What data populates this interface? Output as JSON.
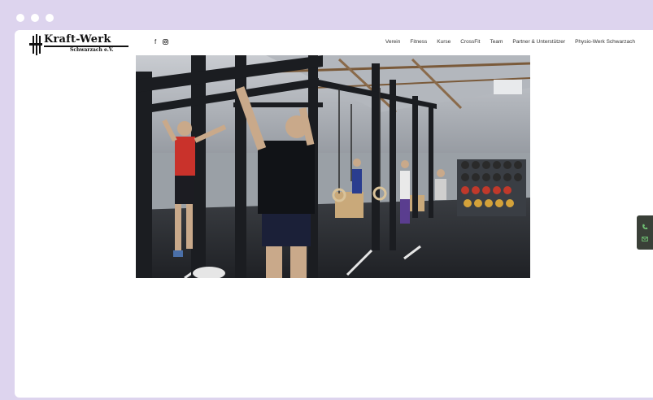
{
  "brand": {
    "title": "Kraft-Werk",
    "subtitle": "Schwarzach e.V."
  },
  "social": {
    "facebook_label": "f",
    "facebook_icon": "facebook-icon",
    "instagram_icon": "instagram-icon"
  },
  "nav": {
    "items": [
      "Verein",
      "Fitness",
      "Kurse",
      "CrossFit",
      "Team",
      "Partner & Unterstützer",
      "Physio-Werk Schwarzach"
    ]
  },
  "side_tab": {
    "phone_icon": "phone-icon",
    "mail_icon": "mail-icon"
  },
  "colors": {
    "frame": "#ddd4ee",
    "side_tab": "#3a4038",
    "accent": "#6fbf73"
  }
}
